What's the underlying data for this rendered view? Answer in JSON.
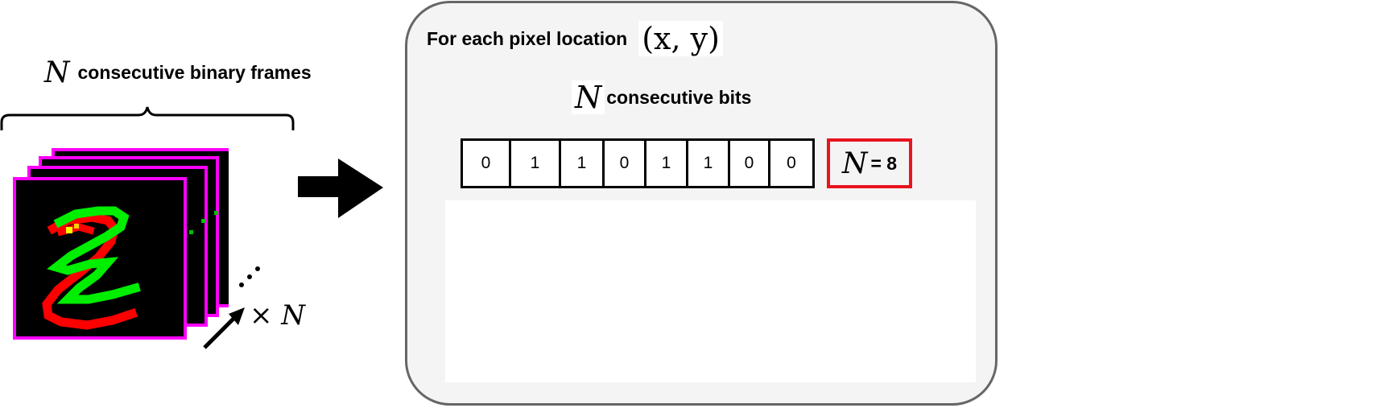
{
  "frames_label": {
    "symbol": "N",
    "text": "consecutive binary frames"
  },
  "frames_multiplier": "× N",
  "panel": {
    "heading": "For each pixel location",
    "coordinate": "(x, y)",
    "bits_label": {
      "symbol": "N",
      "text": "consecutive bits"
    },
    "bits": [
      "0",
      "1",
      "1",
      "0",
      "1",
      "1",
      "0",
      "0"
    ],
    "n_value": {
      "symbol": "N",
      "text": "= 8"
    }
  },
  "colors": {
    "frame_border": "#ff00ff",
    "digit_red": "#ff0000",
    "digit_green": "#00ff00",
    "highlight_red": "#e8141e",
    "panel_border": "#666666",
    "panel_fill": "#f4f4f4"
  }
}
